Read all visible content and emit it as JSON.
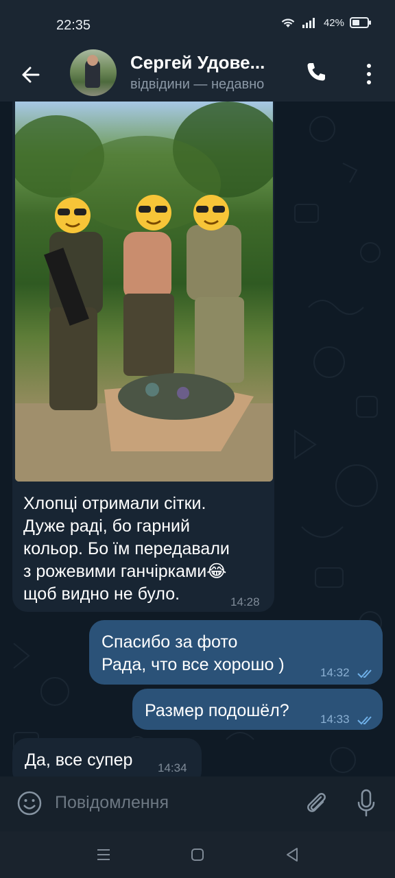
{
  "status_bar": {
    "time": "22:35",
    "battery": "42%"
  },
  "header": {
    "name": "Сергей Удове...",
    "status": "відвідини — недавно"
  },
  "messages": {
    "photo_caption": {
      "text": "Хлопці отримали сітки.\nДуже раді, бо гарний\nкольор. Бо їм передавали\nз рожевими ганчірками😂\nщоб видно не було.",
      "time": "14:28"
    },
    "out1": {
      "text": "Спасибо за фото\nРада, что все хорошо )",
      "time": "14:32"
    },
    "out2": {
      "text": "Размер подошёл?",
      "time": "14:33"
    },
    "in2": {
      "text": "Да, все супер",
      "time": "14:34"
    }
  },
  "input": {
    "placeholder": "Повідомлення"
  },
  "icons": [
    "back-arrow-icon",
    "phone-icon",
    "more-vertical-icon",
    "emoji-icon",
    "attach-icon",
    "mic-icon",
    "wifi-icon",
    "signal-icon",
    "battery-icon",
    "nav-menu-icon",
    "nav-home-icon",
    "nav-back-icon"
  ],
  "colors": {
    "outgoing_bubble": "#2b5278",
    "incoming_bubble": "#182533",
    "background": "#0e1621",
    "check": "#6fb0e8"
  }
}
